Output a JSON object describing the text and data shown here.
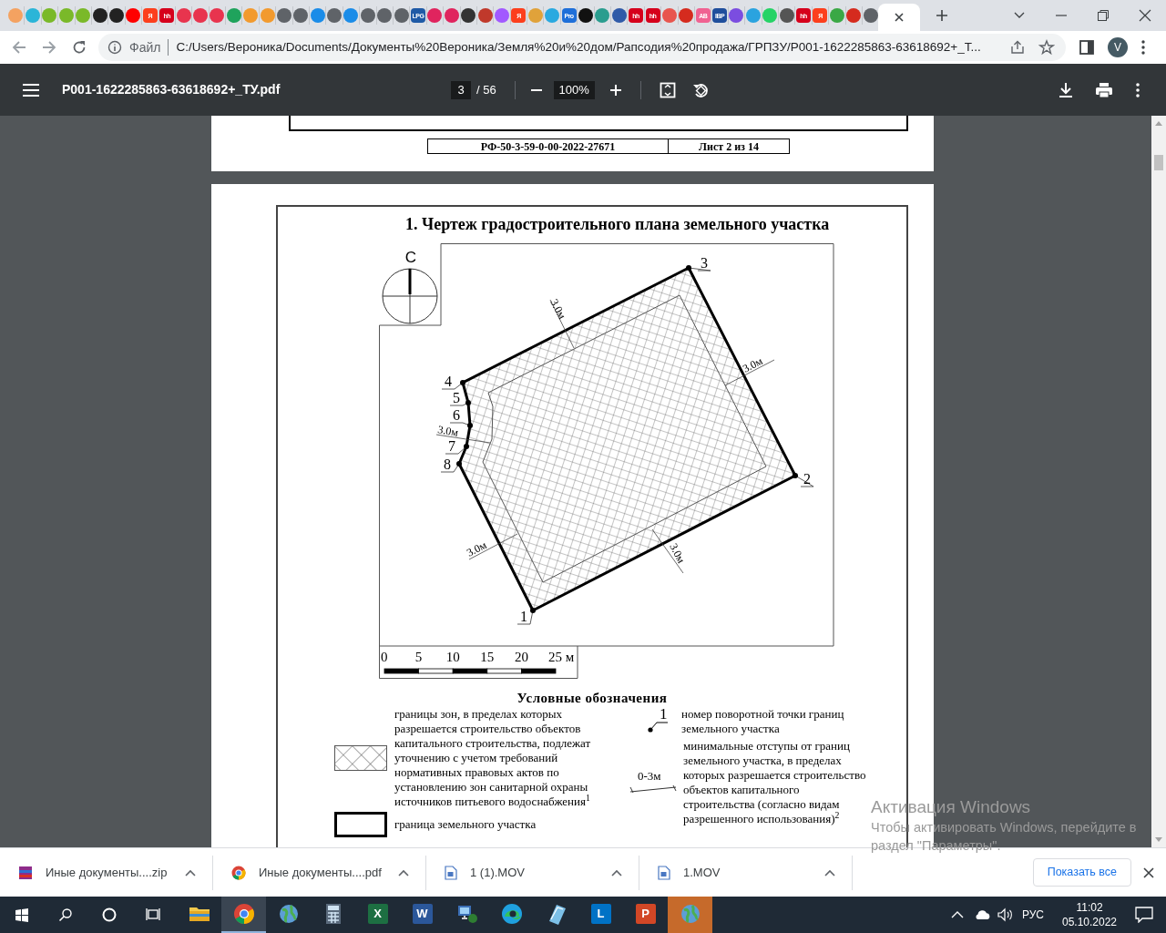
{
  "browser": {
    "pinned_tabs": [
      {
        "color": "#f4a261"
      },
      {
        "color": "#2bb5d8"
      },
      {
        "color": "#7ab929"
      },
      {
        "color": "#7ab929"
      },
      {
        "color": "#7ab929"
      },
      {
        "color": "#222222"
      },
      {
        "color": "#222222"
      },
      {
        "color": "#ff0000"
      },
      {
        "color": "#fc3f1d",
        "glyph": "Я"
      },
      {
        "color": "#d6001c",
        "glyph": "hh"
      },
      {
        "color": "#e8344e"
      },
      {
        "color": "#e8344e"
      },
      {
        "color": "#e8344e"
      },
      {
        "color": "#1fa35c"
      },
      {
        "color": "#f29a2e"
      },
      {
        "color": "#f29a2e"
      },
      {
        "color": "#5f6368"
      },
      {
        "color": "#5f6368"
      },
      {
        "color": "#1a8ce8"
      },
      {
        "color": "#5f6368"
      },
      {
        "color": "#1a8ce8"
      },
      {
        "color": "#5f6368"
      },
      {
        "color": "#5f6368"
      },
      {
        "color": "#5f6368"
      },
      {
        "color": "#1f5aa6",
        "glyph": "LPG"
      },
      {
        "color": "#e0245e"
      },
      {
        "color": "#e0245e"
      },
      {
        "color": "#333333"
      },
      {
        "color": "#c0392b"
      },
      {
        "color": "#a259ff"
      },
      {
        "color": "#fc3f1d",
        "glyph": "Я"
      },
      {
        "color": "#e0a23a"
      },
      {
        "color": "#2aa9e0"
      },
      {
        "color": "#1e6fd9",
        "glyph": "Pro"
      },
      {
        "color": "#111111"
      },
      {
        "color": "#2a9d8f"
      },
      {
        "color": "#2f5aa8"
      },
      {
        "color": "#d6001c",
        "glyph": "hh"
      },
      {
        "color": "#d6001c",
        "glyph": "hh"
      },
      {
        "color": "#e8554e"
      },
      {
        "color": "#d52b1e"
      },
      {
        "color": "#f06292",
        "glyph": "AB"
      },
      {
        "color": "#1f4e9c",
        "glyph": "IBP"
      },
      {
        "color": "#7b4de0"
      },
      {
        "color": "#2aa3df"
      },
      {
        "color": "#25d366"
      },
      {
        "color": "#555555"
      },
      {
        "color": "#d6001c",
        "glyph": "hh"
      },
      {
        "color": "#fc3f1d",
        "glyph": "Я"
      },
      {
        "color": "#3aa845"
      },
      {
        "color": "#d52b1e"
      },
      {
        "color": "#5f6368"
      }
    ],
    "address": {
      "scheme": "Файл",
      "url": "C:/Users/Вероника/Documents/Документы%20Вероника/Земля%20и%20дом/Рапсодия%20продажа/ГРПЗУ/P001-1622285863-63618692+_Т...",
      "profile": "V"
    }
  },
  "pdf_toolbar": {
    "title": "P001-1622285863-63618692+_ТУ.pdf",
    "page": "3",
    "page_count": "/ 56",
    "zoom": "100%"
  },
  "previous_page": {
    "stamp": [
      "РФ-50-3-59-0-00-2022-27671",
      "Лист 2 из 14"
    ]
  },
  "page": {
    "title": "1. Чертеж градостроительного плана земельного участка",
    "compass": "С",
    "points": [
      "1",
      "2",
      "3",
      "4",
      "5",
      "6",
      "7",
      "8"
    ],
    "setbacks": [
      "3.0м",
      "3.0м",
      "3.0м",
      "3.0м",
      "3.0м"
    ],
    "scale": [
      "0",
      "5",
      "10",
      "15",
      "20",
      "25 м"
    ],
    "legend": {
      "title": "Условные обозначения",
      "items": [
        {
          "kind": "hatch",
          "text": "границы зон, в пределах которых\nразрешается строительство объектов\nкапитального строительства, подлежат\nуточнению с учетом требований\nнормативных правовых актов по\nустановлению зон санитарной охраны\nисточников питьевого водоснабжения$^{1}$"
        },
        {
          "kind": "boundary",
          "text": "граница земельного участка"
        },
        {
          "kind": "point",
          "marker": "1",
          "text": "номер поворотной точки границ\nземельного участка"
        },
        {
          "kind": "setback",
          "marker": "0-3м",
          "text": "минимальные отступы от границ\nземельного участка, в пределах\nкоторых разрешается строительство\nобъектов капитального\nстроительства (согласно видам\nразрешенного использования)$^{2}$"
        }
      ]
    }
  },
  "activation": {
    "title": "Активация Windows",
    "text": "Чтобы активировать Windows, перейдите в раздел \"Параметры\"."
  },
  "downloads": {
    "items": [
      {
        "kind": "archive",
        "name": "Иные документы....zip"
      },
      {
        "kind": "chrome",
        "name": "Иные документы....pdf"
      },
      {
        "kind": "video",
        "name": "1 (1).MOV"
      },
      {
        "kind": "video",
        "name": "1.MOV"
      }
    ],
    "show_all": "Показать все"
  },
  "taskbar": {
    "apps": [
      {
        "kind": "explorer",
        "selected": false,
        "flashing": false
      },
      {
        "kind": "chrome",
        "selected": true,
        "flashing": false
      },
      {
        "kind": "globe",
        "selected": false,
        "flashing": false
      },
      {
        "kind": "calculator",
        "selected": false,
        "flashing": false
      },
      {
        "kind": "letter",
        "glyph": "X",
        "color": "#1d6f42",
        "selected": false,
        "flashing": false
      },
      {
        "kind": "letter",
        "glyph": "W",
        "color": "#2b579a",
        "selected": false,
        "flashing": false
      },
      {
        "kind": "network",
        "selected": false,
        "flashing": false
      },
      {
        "kind": "edge",
        "selected": false,
        "flashing": false
      },
      {
        "kind": "notepad",
        "selected": false,
        "flashing": false
      },
      {
        "kind": "letter",
        "glyph": "L",
        "color": "#0072c6",
        "selected": false,
        "flashing": false
      },
      {
        "kind": "letter",
        "glyph": "P",
        "color": "#d24726",
        "selected": false,
        "flashing": false
      },
      {
        "kind": "globe",
        "selected": false,
        "flashing": true
      }
    ],
    "language": "РУС",
    "time": "11:02",
    "date": "05.10.2022"
  }
}
